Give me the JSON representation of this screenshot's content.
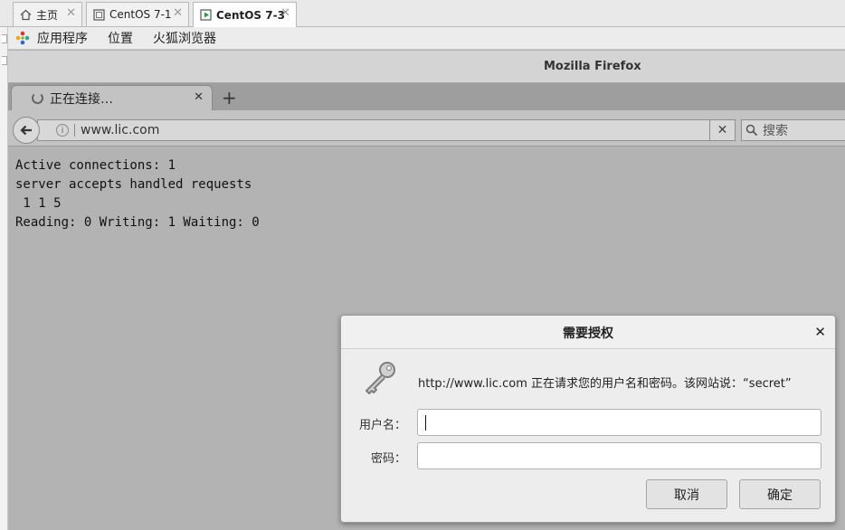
{
  "vm_tabs": [
    {
      "label": "主页",
      "icon": "home-icon"
    },
    {
      "label": "CentOS 7-1",
      "icon": "vm-icon"
    },
    {
      "label": "CentOS 7-3",
      "icon": "vm-running-icon",
      "active": true
    }
  ],
  "gnome_menu": {
    "applications": "应用程序",
    "places": "位置",
    "browser": "火狐浏览器"
  },
  "firefox": {
    "window_title": "Mozilla Firefox",
    "tab": {
      "label": "正在连接…",
      "icon": "loading-icon"
    },
    "url": "www.lic.com",
    "search_placeholder": "搜索"
  },
  "page_content": {
    "lines": [
      "Active connections: 1",
      "server accepts handled requests",
      " 1 1 5",
      "Reading: 0 Writing: 1 Waiting: 0"
    ]
  },
  "auth_dialog": {
    "title": "需要授权",
    "message": "http://www.lic.com 正在请求您的用户名和密码。该网站说：“secret”",
    "username_label": "用户名：",
    "password_label": "密码：",
    "username_value": "",
    "password_value": "",
    "cancel_label": "取消",
    "ok_label": "确定"
  }
}
